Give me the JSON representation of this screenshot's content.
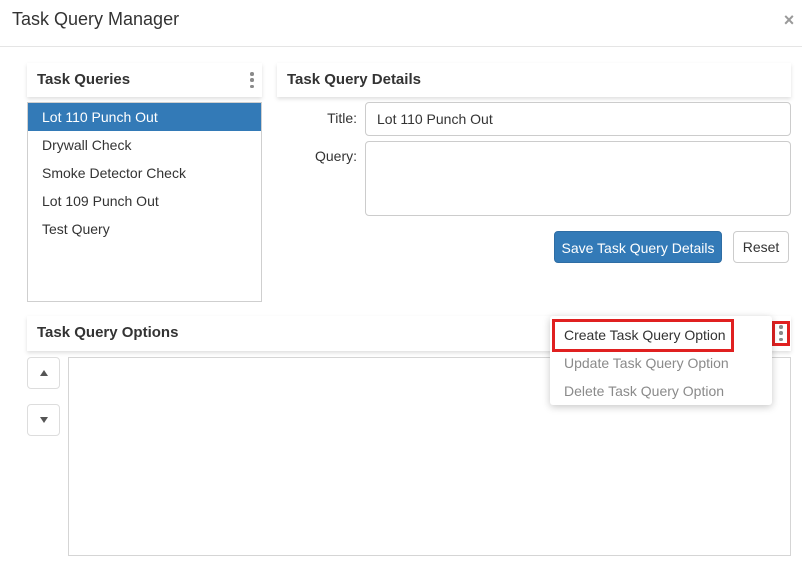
{
  "dialog": {
    "title": "Task Query Manager",
    "close_glyph": "×"
  },
  "queries_panel": {
    "title": "Task Queries",
    "selected_index": 0,
    "items": [
      {
        "label": "Lot 110 Punch Out"
      },
      {
        "label": "Drywall Check"
      },
      {
        "label": "Smoke Detector Check"
      },
      {
        "label": "Lot 109 Punch Out"
      },
      {
        "label": "Test Query"
      }
    ]
  },
  "details_panel": {
    "title": "Task Query Details",
    "title_label": "Title:",
    "title_value": "Lot 110 Punch Out",
    "query_label": "Query:",
    "query_value": "",
    "save_label": "Save Task Query Details",
    "reset_label": "Reset"
  },
  "options_panel": {
    "title": "Task Query Options",
    "menu": {
      "items": [
        {
          "label": "Create Task Query Option",
          "enabled": true,
          "highlighted": true
        },
        {
          "label": "Update Task Query Option",
          "enabled": false
        },
        {
          "label": "Delete Task Query Option",
          "enabled": false
        }
      ]
    }
  },
  "colors": {
    "accent": "#337ab7",
    "highlight": "#e02020"
  },
  "icons": {
    "close": "close-icon",
    "kebab": "kebab-menu-icon",
    "up": "arrow-up-icon",
    "down": "arrow-down-icon"
  }
}
